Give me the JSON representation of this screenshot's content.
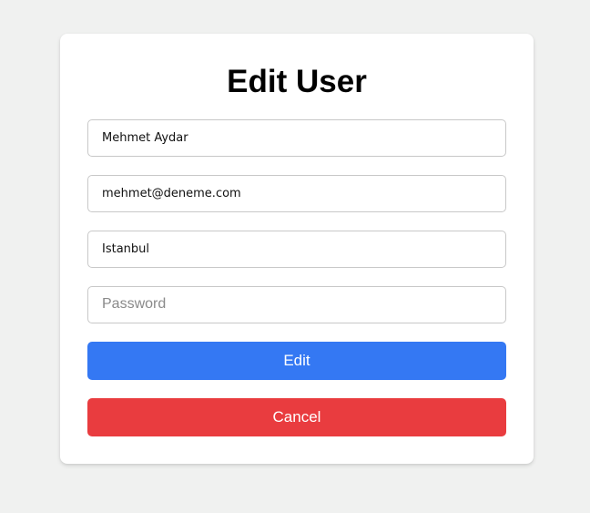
{
  "form": {
    "title": "Edit User",
    "name_value": "Mehmet Aydar",
    "email_value": "mehmet@deneme.com",
    "city_value": "İstanbul",
    "password_value": "",
    "password_placeholder": "Password",
    "edit_label": "Edit",
    "cancel_label": "Cancel"
  },
  "colors": {
    "background": "#f0f1f0",
    "card": "#ffffff",
    "edit_button": "#3478f3",
    "cancel_button": "#e93c3f",
    "field_border": "#c8c8c8"
  }
}
